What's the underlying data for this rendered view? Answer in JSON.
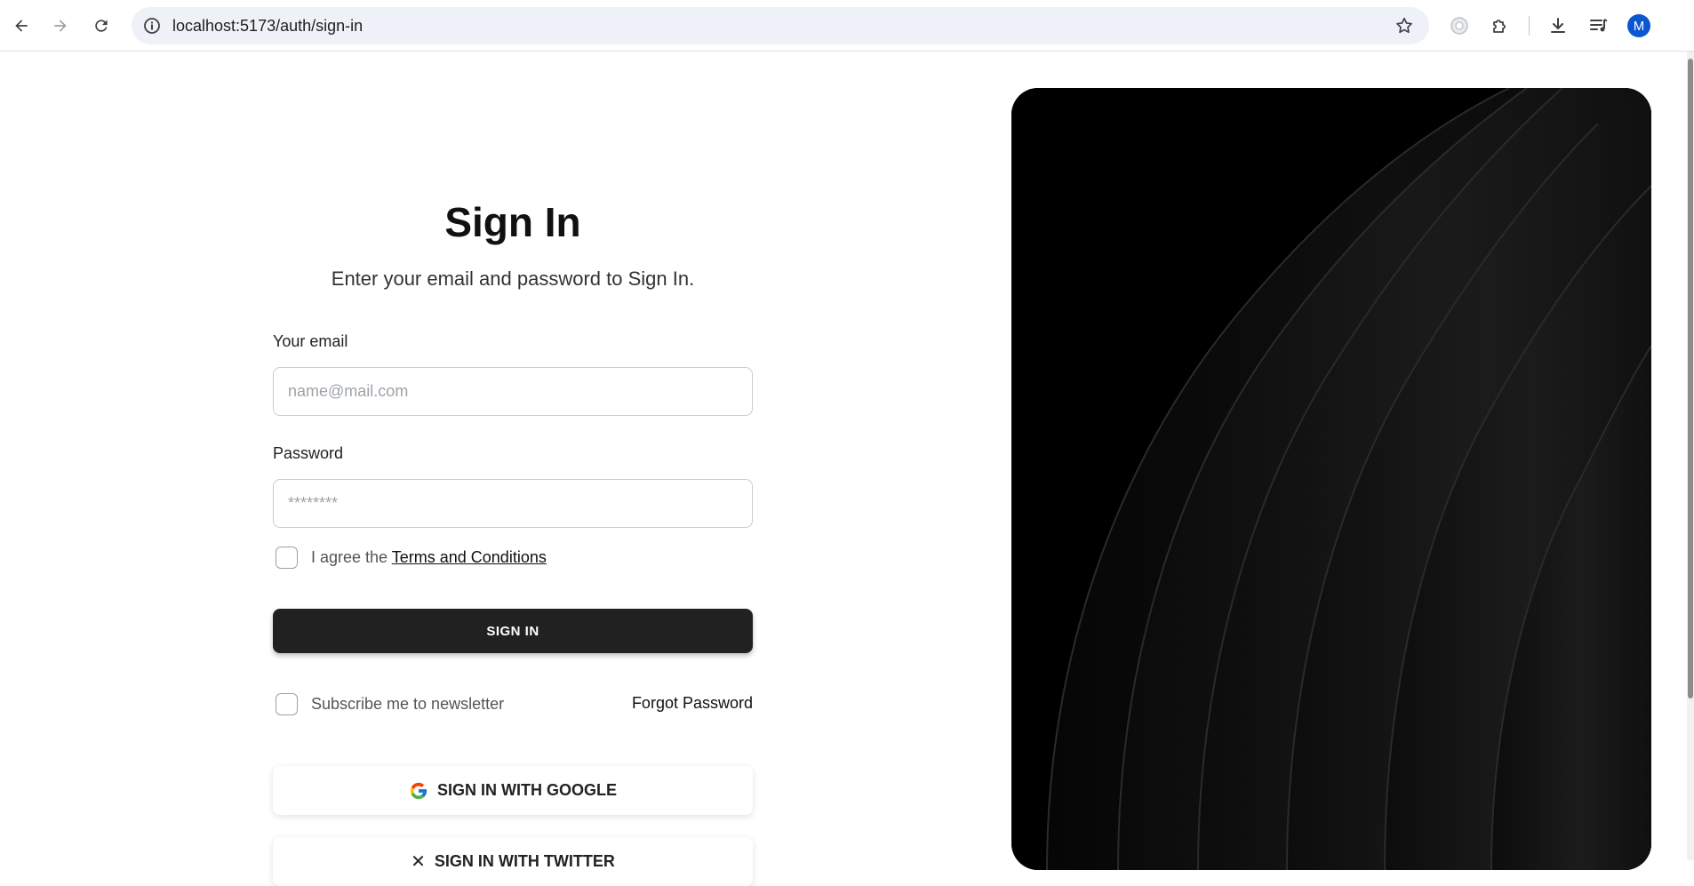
{
  "browser": {
    "url": "localhost:5173/auth/sign-in",
    "profile_initial": "M",
    "icons": [
      "back-arrow-icon",
      "forward-arrow-icon",
      "reload-icon",
      "site-info-icon",
      "bookmark-star-icon",
      "extension-icon",
      "puzzle-icon",
      "download-icon",
      "media-control-icon"
    ]
  },
  "form": {
    "title": "Sign In",
    "subtitle": "Enter your email and password to Sign In.",
    "email_label": "Your email",
    "email_placeholder": "name@mail.com",
    "password_label": "Password",
    "password_placeholder": "********",
    "agree_prefix": "I agree the",
    "terms_link": "Terms and Conditions",
    "signin_label": "SIGN IN",
    "newsletter_label": "Subscribe me to newsletter",
    "forgot_label": "Forgot Password",
    "google_label": "SIGN IN WITH GOOGLE",
    "twitter_label": "SIGN IN WITH TWITTER"
  },
  "colors": {
    "button_bg": "#212121",
    "hero_bg": "#000000",
    "profile_bg": "#0b57d0"
  }
}
